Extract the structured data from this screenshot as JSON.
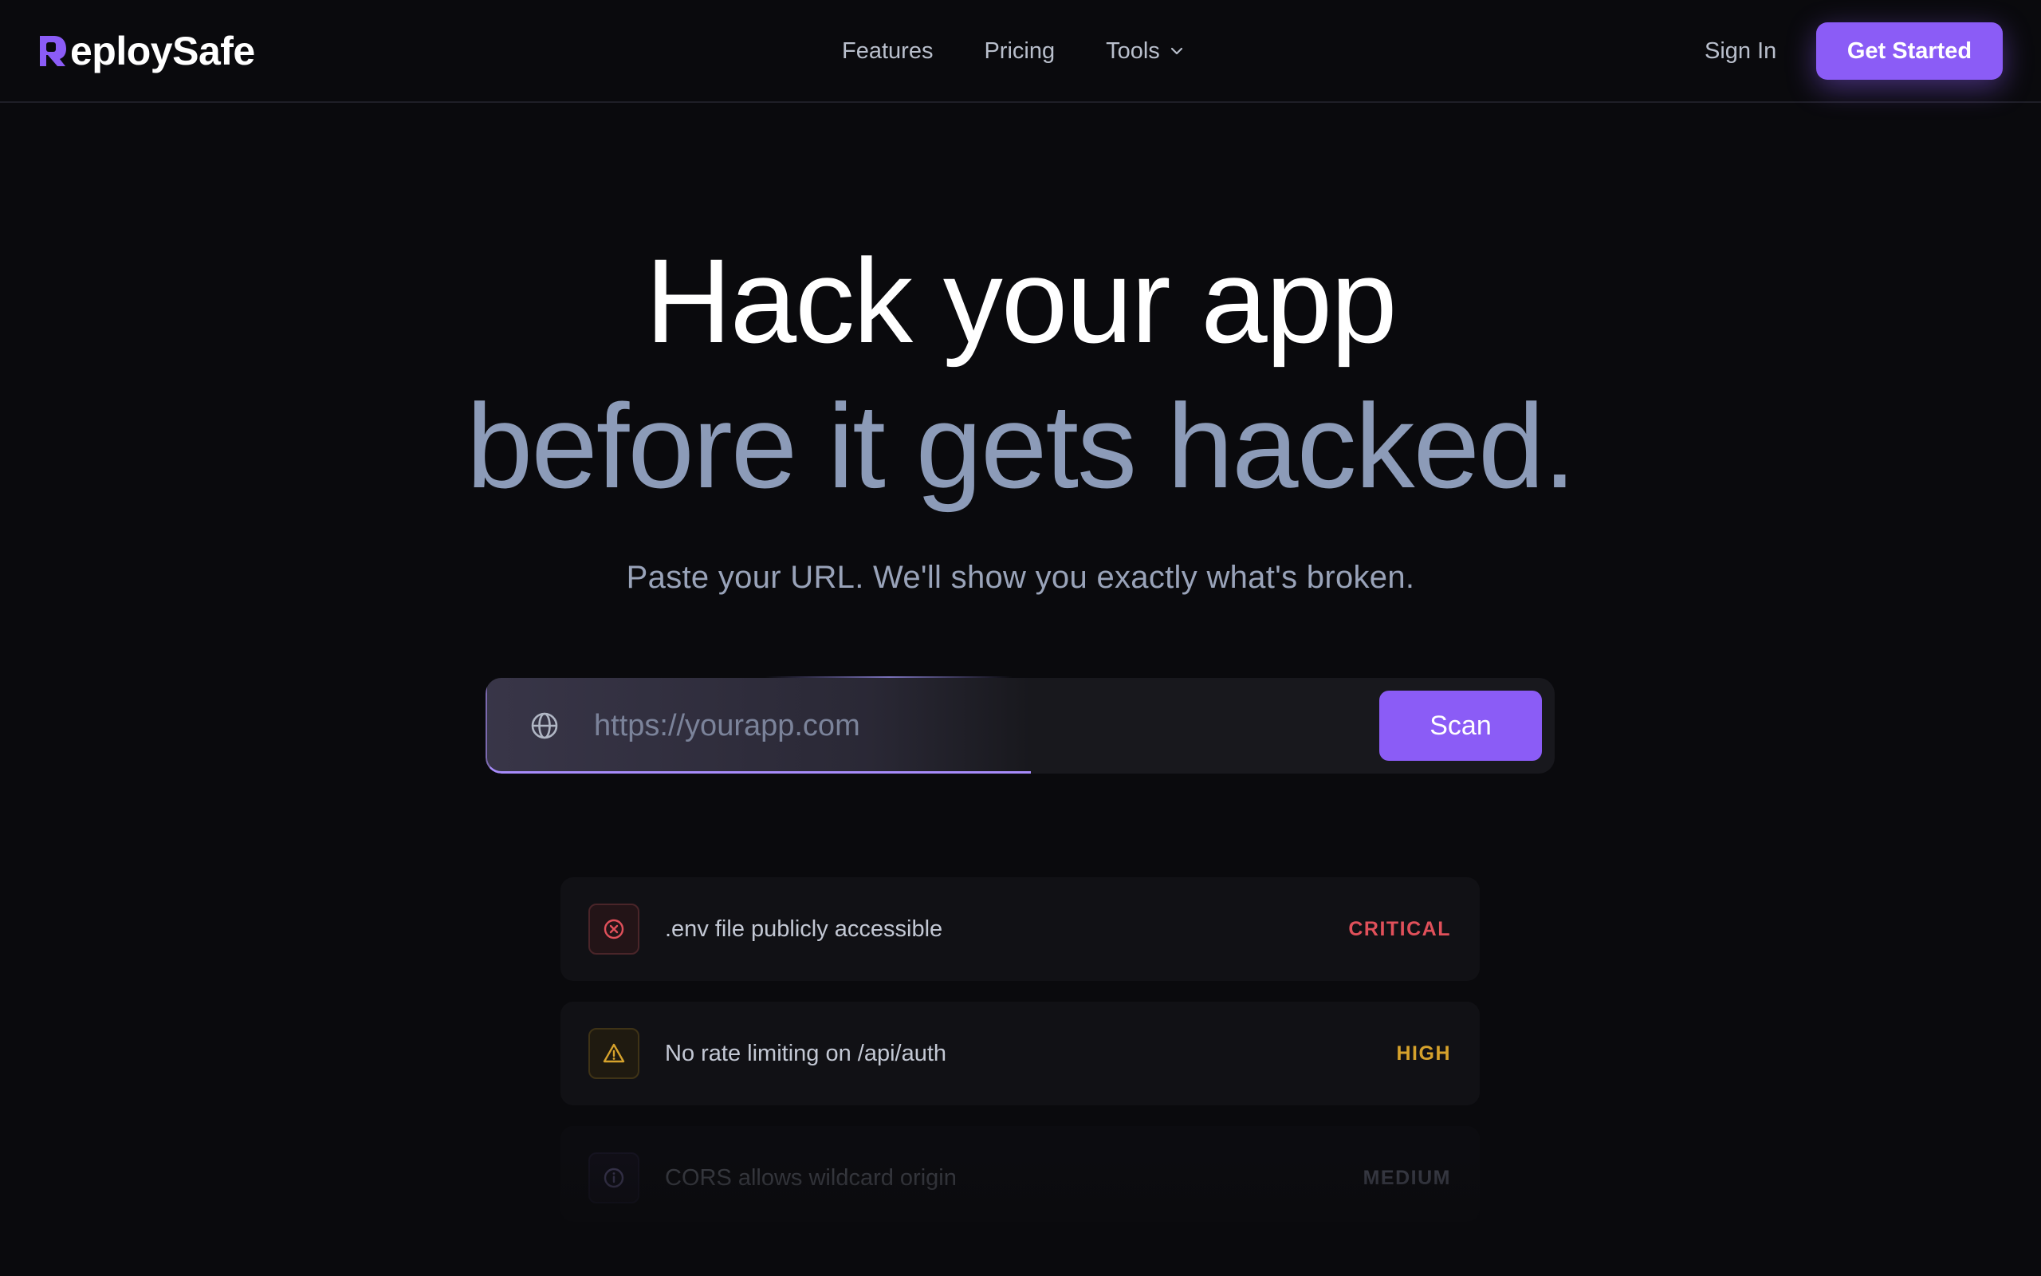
{
  "nav": {
    "brand": "eploySafe",
    "links": [
      {
        "label": "Features"
      },
      {
        "label": "Pricing"
      },
      {
        "label": "Tools"
      }
    ],
    "sign_in": "Sign In",
    "cta": "Get Started"
  },
  "hero": {
    "line1": "Hack your app",
    "line2": "before it gets hacked.",
    "subtitle": "Paste your URL. We'll show you exactly what's broken."
  },
  "scan": {
    "placeholder": "https://yourapp.com",
    "button": "Scan"
  },
  "findings": [
    {
      "title": ".env file publicly accessible",
      "severity": "CRITICAL",
      "icon": "x-circle-icon"
    },
    {
      "title": "No rate limiting on /api/auth",
      "severity": "HIGH",
      "icon": "warning-triangle-icon"
    },
    {
      "title": "CORS allows wildcard origin",
      "severity": "MEDIUM",
      "icon": "info-circle-icon"
    }
  ],
  "colors": {
    "accent": "#8b5cf6",
    "background": "#0a0a0d",
    "critical": "#e0505a",
    "high": "#d6a22c",
    "medium": "#9aa0b8"
  }
}
